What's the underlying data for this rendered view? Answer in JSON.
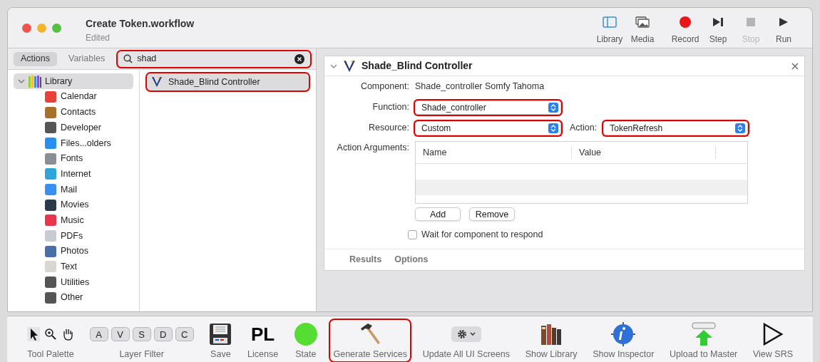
{
  "window": {
    "title": "Create Token.workflow",
    "subtitle": "Edited"
  },
  "toolbar": [
    {
      "kind": "library",
      "label": "Library",
      "disabled": false
    },
    {
      "kind": "media",
      "label": "Media",
      "disabled": false
    },
    {
      "kind": "record",
      "label": "Record",
      "disabled": false
    },
    {
      "kind": "step",
      "label": "Step",
      "disabled": false
    },
    {
      "kind": "stop",
      "label": "Stop",
      "disabled": true
    },
    {
      "kind": "run",
      "label": "Run",
      "disabled": false
    }
  ],
  "tabs": [
    {
      "label": "Actions",
      "selected": true
    },
    {
      "label": "Variables",
      "selected": false
    }
  ],
  "search": {
    "value": "shad",
    "highlighted": true
  },
  "library": {
    "label": "Library",
    "expanded": true,
    "selected": true,
    "children": [
      {
        "label": "Calendar",
        "color": "#e8413c"
      },
      {
        "label": "Contacts",
        "color": "#a8702a"
      },
      {
        "label": "Developer",
        "color": "#555555"
      },
      {
        "label": "Files...olders",
        "color": "#2a8ef0"
      },
      {
        "label": "Fonts",
        "color": "#8a8f96"
      },
      {
        "label": "Internet",
        "color": "#2fa6d8"
      },
      {
        "label": "Mail",
        "color": "#3a8ff0"
      },
      {
        "label": "Movies",
        "color": "#2a3a4a"
      },
      {
        "label": "Music",
        "color": "#e8364c"
      },
      {
        "label": "PDFs",
        "color": "#c8ccd2"
      },
      {
        "label": "Photos",
        "color": "#4a6fa8"
      },
      {
        "label": "Text",
        "color": "#d8d8d0"
      },
      {
        "label": "Utilities",
        "color": "#555555"
      },
      {
        "label": "Other",
        "color": "#555555"
      }
    ]
  },
  "results": [
    {
      "label": "Shade_Blind Controller",
      "selected": true,
      "highlighted": true
    }
  ],
  "action": {
    "title": "Shade_Blind Controller",
    "expanded": true,
    "component_label": "Component:",
    "component_value": "Shade_controller Somfy Tahoma",
    "function": {
      "label": "Function:",
      "value": "Shade_controller",
      "highlighted": true
    },
    "resource": {
      "label": "Resource:",
      "value": "Custom",
      "highlighted": true
    },
    "action_select": {
      "label": "Action:",
      "value": "TokenRefresh",
      "highlighted": true
    },
    "arguments_label": "Action Arguments:",
    "columns": [
      "Name",
      "Value"
    ],
    "buttons": [
      "Add",
      "Remove"
    ],
    "wait": {
      "label": "Wait for component to respond",
      "checked": false
    },
    "footer_tabs": [
      "Results",
      "Options"
    ]
  },
  "bottom_toolbar": [
    {
      "kind": "tools",
      "label": "Tool Palette"
    },
    {
      "kind": "filter",
      "label": "Layer Filter",
      "keys": [
        "A",
        "V",
        "S",
        "D",
        "C"
      ]
    },
    {
      "kind": "save",
      "label": "Save"
    },
    {
      "kind": "license",
      "label": "License",
      "text": "PL"
    },
    {
      "kind": "state",
      "label": "State",
      "color": "#55dd33"
    },
    {
      "kind": "hammer",
      "label": "Generate Services",
      "highlighted": true
    },
    {
      "kind": "gear",
      "label": "Update All UI Screens"
    },
    {
      "kind": "books",
      "label": "Show Library"
    },
    {
      "kind": "info",
      "label": "Show Inspector"
    },
    {
      "kind": "upload",
      "label": "Upload to Master"
    },
    {
      "kind": "play",
      "label": "View SRS"
    }
  ]
}
